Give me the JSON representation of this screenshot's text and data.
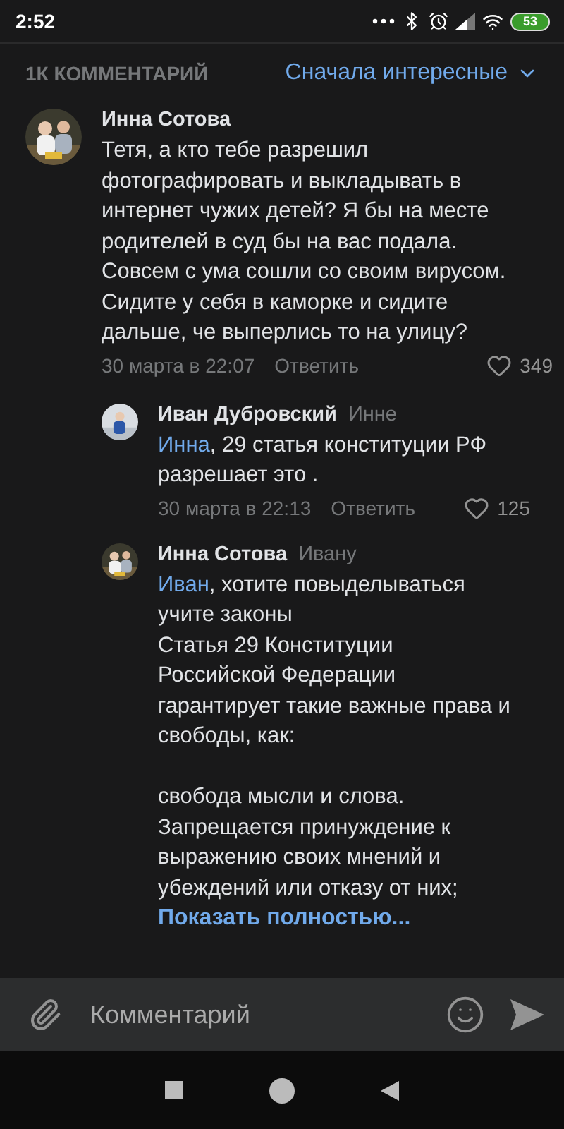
{
  "status_bar": {
    "time": "2:52",
    "battery": "53"
  },
  "header": {
    "count": "1К КОММЕНТАРИЙ",
    "sort": "Сначала интересные"
  },
  "comments": [
    {
      "author": "Инна Сотова",
      "text": "Тетя, а кто тебе разрешил фотографировать и выкладывать в интернет чужих детей? Я бы на месте родителей в суд бы на вас подала. Совсем с ума сошли со своим вирусом. Сидите у себя в каморке и сидите дальше, че выперлись то на улицу?",
      "date": "30 марта в 22:07",
      "reply": "Ответить",
      "likes": "349",
      "nested": false
    },
    {
      "author": "Иван Дубровский",
      "reply_to": "Инне",
      "mention": "Инна",
      "text": ", 29 статья конституции РФ разрешает это .",
      "date": "30 марта в 22:13",
      "reply": "Ответить",
      "likes": "125",
      "nested": true
    },
    {
      "author": "Инна Сотова",
      "reply_to": "Ивану",
      "mention": "Иван",
      "text": ", хотите повыделываться учите законы\nСтатья 29 Конституции Российской Федерации гарантирует такие важные права и свободы, как:\n\nсвобода мысли и слова. Запрещается принуждение к выражению своих мнений и убеждений или отказу от них;",
      "more": "Показать полностью...",
      "nested": true
    }
  ],
  "composer": {
    "placeholder": "Комментарий"
  }
}
